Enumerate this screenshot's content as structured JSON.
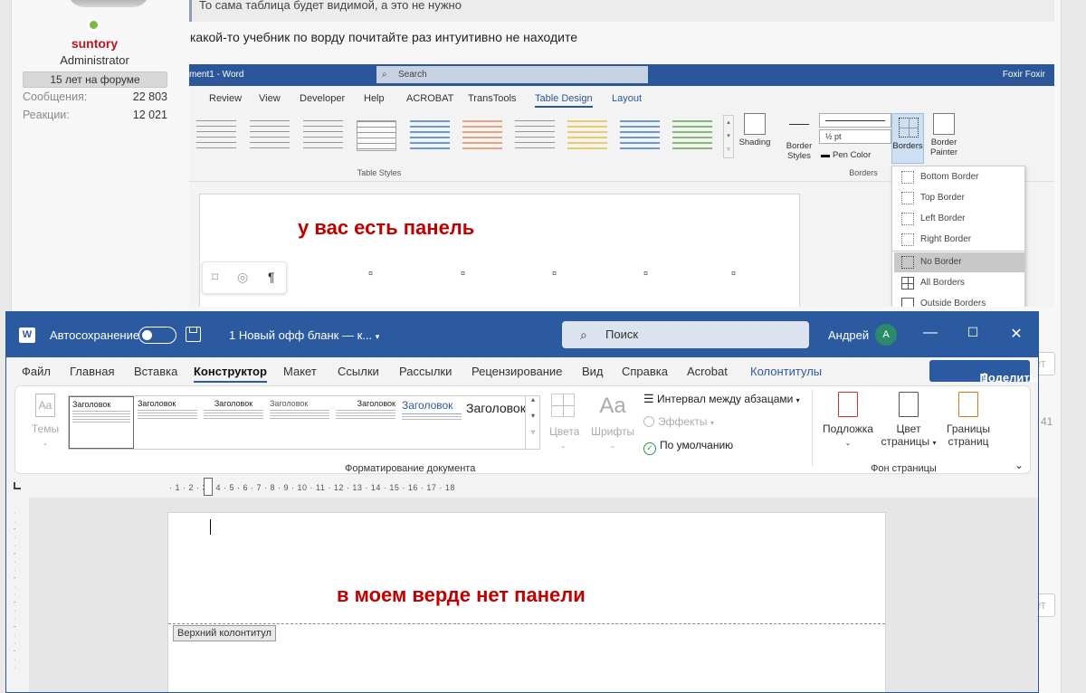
{
  "forum": {
    "username": "suntory",
    "role": "Administrator",
    "badge": "15 лет на форуме",
    "stats": [
      {
        "label": "Сообщения:",
        "value": "22 803"
      },
      {
        "label": "Реакции:",
        "value": "12 021"
      }
    ],
    "quote_text": "То сама таблица будет видимой, а это не нужно",
    "post_text": "какой-то учебник по ворду почитайте раз интуитивно не находите",
    "side_number": "41",
    "side_btn": "ет",
    "side_btn2": "ет"
  },
  "shot1": {
    "title_doc": "ment1 - Word",
    "search": "Search",
    "user": "Foxir Foxir",
    "tabs": [
      "Review",
      "View",
      "Developer",
      "Help",
      "ACROBAT",
      "TransTools",
      "Table Design",
      "Layout"
    ],
    "active_tab": "Table Design",
    "group_table_styles": "Table Styles",
    "group_borders": "Borders",
    "shading": "Shading",
    "border_styles_1": "Border",
    "border_styles_2": "Styles",
    "pen_weight": "½ pt",
    "pen_color": "Pen Color",
    "borders": "Borders",
    "border_painter_1": "Border",
    "border_painter_2": "Painter",
    "annotation": "у вас есть панель",
    "borders_menu": [
      "Bottom Border",
      "Top Border",
      "Left Border",
      "Right Border",
      "No Border",
      "All Borders",
      "Outside Borders"
    ],
    "highlighted_item": "No Border"
  },
  "shot2": {
    "autosave": "Автосохранение",
    "doc_title": "1 Новый офф бланк — к...",
    "search": "Поиск",
    "user": "Андрей",
    "avatar_letter": "A",
    "menu": [
      "Файл",
      "Главная",
      "Вставка",
      "Конструктор",
      "Макет",
      "Ссылки",
      "Рассылки",
      "Рецензирование",
      "Вид",
      "Справка",
      "Acrobat",
      "Колонтитулы"
    ],
    "active_menu": "Конструктор",
    "share": "Поделиться",
    "themes": "Темы",
    "gallery_styles": [
      "Заголовок",
      "Заголовок",
      "Заголовок",
      "Заголовок",
      "Заголовок",
      "Заголовок",
      "Заголовок"
    ],
    "colors": "Цвета",
    "fonts": "Шрифты",
    "fonts_glyph": "Aa",
    "paragraph_spacing": "Интервал между абзацами",
    "effects": "Эффекты",
    "set_default": "По умолчанию",
    "group_format": "Форматирование документа",
    "watermark": "Подложка",
    "page_color_1": "Цвет",
    "page_color_2": "страницы",
    "page_borders_1": "Границы",
    "page_borders_2": "страниц",
    "group_background": "Фон страницы",
    "ruler_marks": "· 1 · 2 · 3 · 4 · 5 · 6 · 7 · 8 · 9 · 10 · 11 · 12 · 13 · 14 · 15 · 16 · 17 · 18",
    "annotation": "в моем верде нет панели",
    "header_tag": "Верхний колонтитул"
  },
  "colors": {
    "word_blue": "#2b579a",
    "annotation_red": "#c00000",
    "username_red": "#c0141e"
  }
}
